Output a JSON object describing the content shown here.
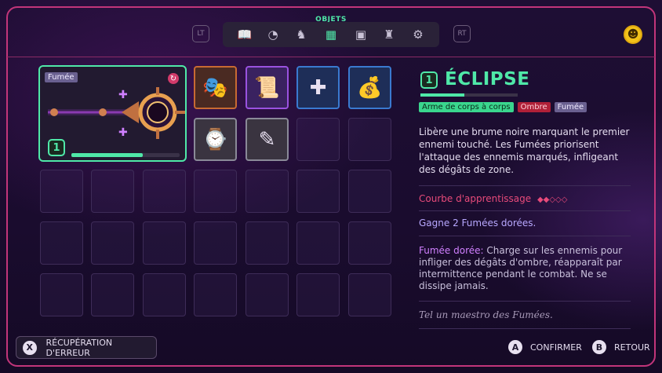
{
  "nav": {
    "title": "OBJETS",
    "lt": "LT",
    "rt": "RT",
    "tabs": [
      {
        "name": "journal-icon",
        "glyph": "📖"
      },
      {
        "name": "gauge-icon",
        "glyph": "◔"
      },
      {
        "name": "paw-icon",
        "glyph": "♞"
      },
      {
        "name": "grid-icon",
        "glyph": "▦"
      },
      {
        "name": "id-card-icon",
        "glyph": "▣"
      },
      {
        "name": "joystick-icon",
        "glyph": "♜"
      },
      {
        "name": "gear-icon",
        "glyph": "⚙"
      }
    ],
    "active_tab": 3,
    "smiley_glyph": "☻"
  },
  "featured": {
    "tag": "Fumée",
    "level": "1",
    "progress": 0.66,
    "weapon_glyph": "✦",
    "curse_glyph": "↻"
  },
  "inventory": [
    {
      "glyph": "🎭",
      "border": "#c86a32",
      "bg": "#4a2a22"
    },
    {
      "glyph": "📜",
      "border": "#9a52e0",
      "bg": "#3a2260"
    },
    {
      "glyph": "✚",
      "border": "#3a7ad0",
      "bg": "#1e2e58"
    },
    {
      "glyph": "💰",
      "border": "#3a7ad0",
      "bg": "#1e2e58"
    },
    {
      "glyph": "⌚",
      "border": "#8a8a98",
      "bg": "#3a3440"
    },
    {
      "glyph": "✎",
      "border": "#8a8a98",
      "bg": "#3a3440"
    }
  ],
  "detail": {
    "level": "1",
    "title": "ÉCLIPSE",
    "xp_progress": 0.45,
    "tags": [
      "Arme de corps à corps",
      "Ombre",
      "Fumée"
    ],
    "description": "Libère une brume noire marquant le premier ennemi touché. Les Fumées priorisent l'attaque des ennemis marqués, infligeant des dégâts de zone.",
    "curve_label": "Courbe d'apprentissage",
    "curve_diamonds": "◆◆◇◇◇",
    "gain": "Gagne 2 Fumées dorées.",
    "golden_label": "Fumée dorée:",
    "golden_text": " Charge sur les ennemis pour infliger des dégâts d'ombre, réapparaît par intermittence pendant le combat. Ne se dissipe jamais.",
    "quote": "Tel un maestro des Fumées."
  },
  "footer": {
    "error_key": "X",
    "error_label": "RÉCUPÉRATION D'ERREUR",
    "confirm_key": "A",
    "confirm_label": "CONFIRMER",
    "back_key": "B",
    "back_label": "RETOUR"
  }
}
